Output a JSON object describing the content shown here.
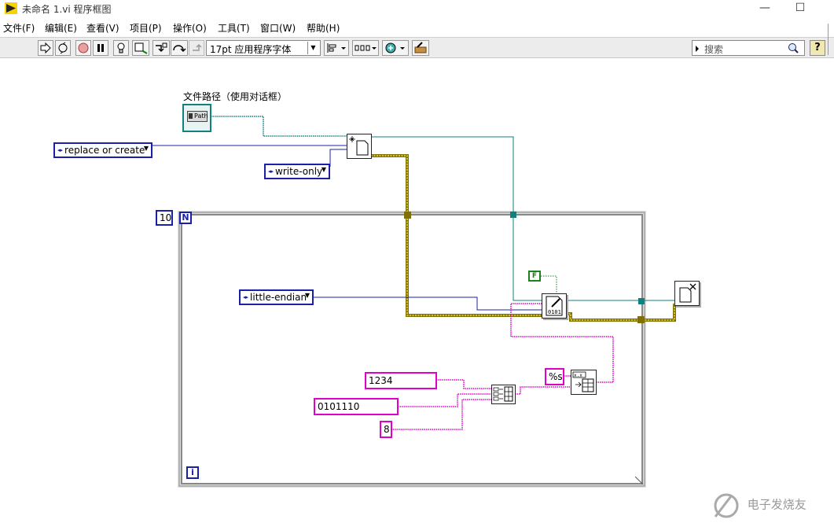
{
  "window": {
    "title": "未命名 1.vi 程序框图",
    "minimize": "—",
    "maximize": "☐"
  },
  "menu": [
    {
      "label": "文件(F)"
    },
    {
      "label": "编辑(E)"
    },
    {
      "label": "查看(V)"
    },
    {
      "label": "项目(P)"
    },
    {
      "label": "操作(O)"
    },
    {
      "label": "工具(T)"
    },
    {
      "label": "窗口(W)"
    },
    {
      "label": "帮助(H)"
    }
  ],
  "toolbar": {
    "font": "17pt 应用程序字体",
    "search_placeholder": "搜索",
    "help": "?"
  },
  "diagram": {
    "path_control_label": "文件路径（使用对话框）",
    "path_control_text": "Path",
    "open_mode": "replace or create",
    "access_mode": "write-only",
    "loop_count": "10",
    "loop_n": "N",
    "loop_i": "i",
    "byte_order": "little-endian",
    "prepend_size": "F",
    "str1": "1234",
    "str2": "0101110",
    "str3": "8",
    "format_str": "%s"
  },
  "colors": {
    "blue_wire": "#1a20a8",
    "teal_wire": "#108080",
    "pink_wire": "#e000c8",
    "refnum_wire": "#807000",
    "bool_green": "#208020"
  },
  "watermark": "电子发烧友"
}
